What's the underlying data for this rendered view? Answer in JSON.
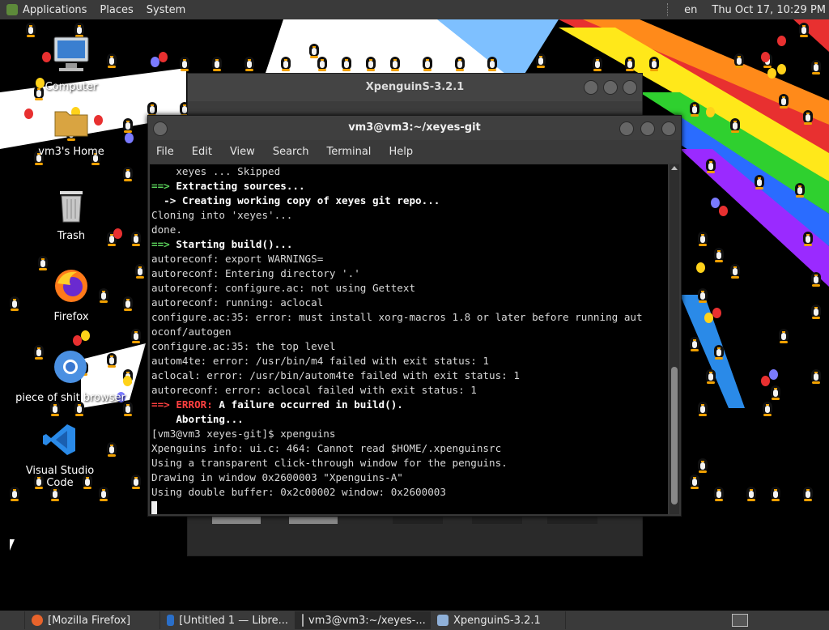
{
  "top_panel": {
    "menus": [
      "Applications",
      "Places",
      "System"
    ],
    "keyboard_layout": "en",
    "clock": "Thu Oct 17, 10:29 PM"
  },
  "desktop_icons": [
    {
      "label": "Computer",
      "icon": "computer-icon"
    },
    {
      "label": "vm3's Home",
      "icon": "home-folder-icon"
    },
    {
      "label": "Trash",
      "icon": "trash-icon"
    },
    {
      "label": "Firefox",
      "icon": "firefox-icon"
    },
    {
      "label": "piece of shit browser",
      "icon": "chrome-icon"
    },
    {
      "label": "Visual Studio Code",
      "icon": "vscode-icon"
    }
  ],
  "back_window": {
    "title": "XpenguinS-3.2.1"
  },
  "terminal": {
    "title": "vm3@vm3:~/xeyes-git",
    "menu": [
      "File",
      "Edit",
      "View",
      "Search",
      "Terminal",
      "Help"
    ],
    "lines": [
      [
        {
          "t": "    xeyes ... Skipped",
          "c": ""
        }
      ],
      [
        {
          "t": "==> ",
          "c": "g"
        },
        {
          "t": "Extracting sources...",
          "c": "b"
        }
      ],
      [
        {
          "t": "  -> ",
          "c": "b"
        },
        {
          "t": "Creating working copy of xeyes git repo...",
          "c": "b"
        }
      ],
      [
        {
          "t": "Cloning into 'xeyes'...",
          "c": ""
        }
      ],
      [
        {
          "t": "done.",
          "c": ""
        }
      ],
      [
        {
          "t": "==> ",
          "c": "g"
        },
        {
          "t": "Starting build()...",
          "c": "b"
        }
      ],
      [
        {
          "t": "autoreconf: export WARNINGS=",
          "c": ""
        }
      ],
      [
        {
          "t": "autoreconf: Entering directory '.'",
          "c": ""
        }
      ],
      [
        {
          "t": "autoreconf: configure.ac: not using Gettext",
          "c": ""
        }
      ],
      [
        {
          "t": "autoreconf: running: aclocal",
          "c": ""
        }
      ],
      [
        {
          "t": "configure.ac:35: error: must install xorg-macros 1.8 or later before running aut",
          "c": ""
        }
      ],
      [
        {
          "t": "oconf/autogen",
          "c": ""
        }
      ],
      [
        {
          "t": "configure.ac:35: the top level",
          "c": ""
        }
      ],
      [
        {
          "t": "autom4te: error: /usr/bin/m4 failed with exit status: 1",
          "c": ""
        }
      ],
      [
        {
          "t": "aclocal: error: /usr/bin/autom4te failed with exit status: 1",
          "c": ""
        }
      ],
      [
        {
          "t": "autoreconf: error: aclocal failed with exit status: 1",
          "c": ""
        }
      ],
      [
        {
          "t": "==> ERROR: ",
          "c": "r"
        },
        {
          "t": "A failure occurred in build().",
          "c": "b"
        }
      ],
      [
        {
          "t": "    Aborting...",
          "c": "b"
        }
      ],
      [
        {
          "t": "[vm3@vm3 xeyes-git]$ xpenguins",
          "c": ""
        }
      ],
      [
        {
          "t": "Xpenguins info: ui.c: 464: Cannot read $HOME/.xpenguinsrc",
          "c": ""
        }
      ],
      [
        {
          "t": "Using a transparent click-through window for the penguins.",
          "c": ""
        }
      ],
      [
        {
          "t": "Drawing in window 0x2600003 \"Xpenguins-A\"",
          "c": ""
        }
      ],
      [
        {
          "t": "Using double buffer: 0x2c00002 window: 0x2600003",
          "c": ""
        }
      ]
    ]
  },
  "taskbar": {
    "tasks": [
      {
        "label": "[Mozilla Firefox]",
        "icon": "firefox-icon",
        "color": "#e8632b"
      },
      {
        "label": "[Untitled 1 — Libre...",
        "icon": "writer-icon",
        "color": "#2a6fc9"
      },
      {
        "label": "vm3@vm3:~/xeyes-...",
        "icon": "terminal-icon",
        "color": "#555555"
      },
      {
        "label": "XpenguinS-3.2.1",
        "icon": "window-icon",
        "color": "#8fb0d8"
      }
    ]
  },
  "colors": {
    "panel": "#3a3a3a",
    "prompt_green": "#5ad05a",
    "error_red": "#ff4040"
  }
}
